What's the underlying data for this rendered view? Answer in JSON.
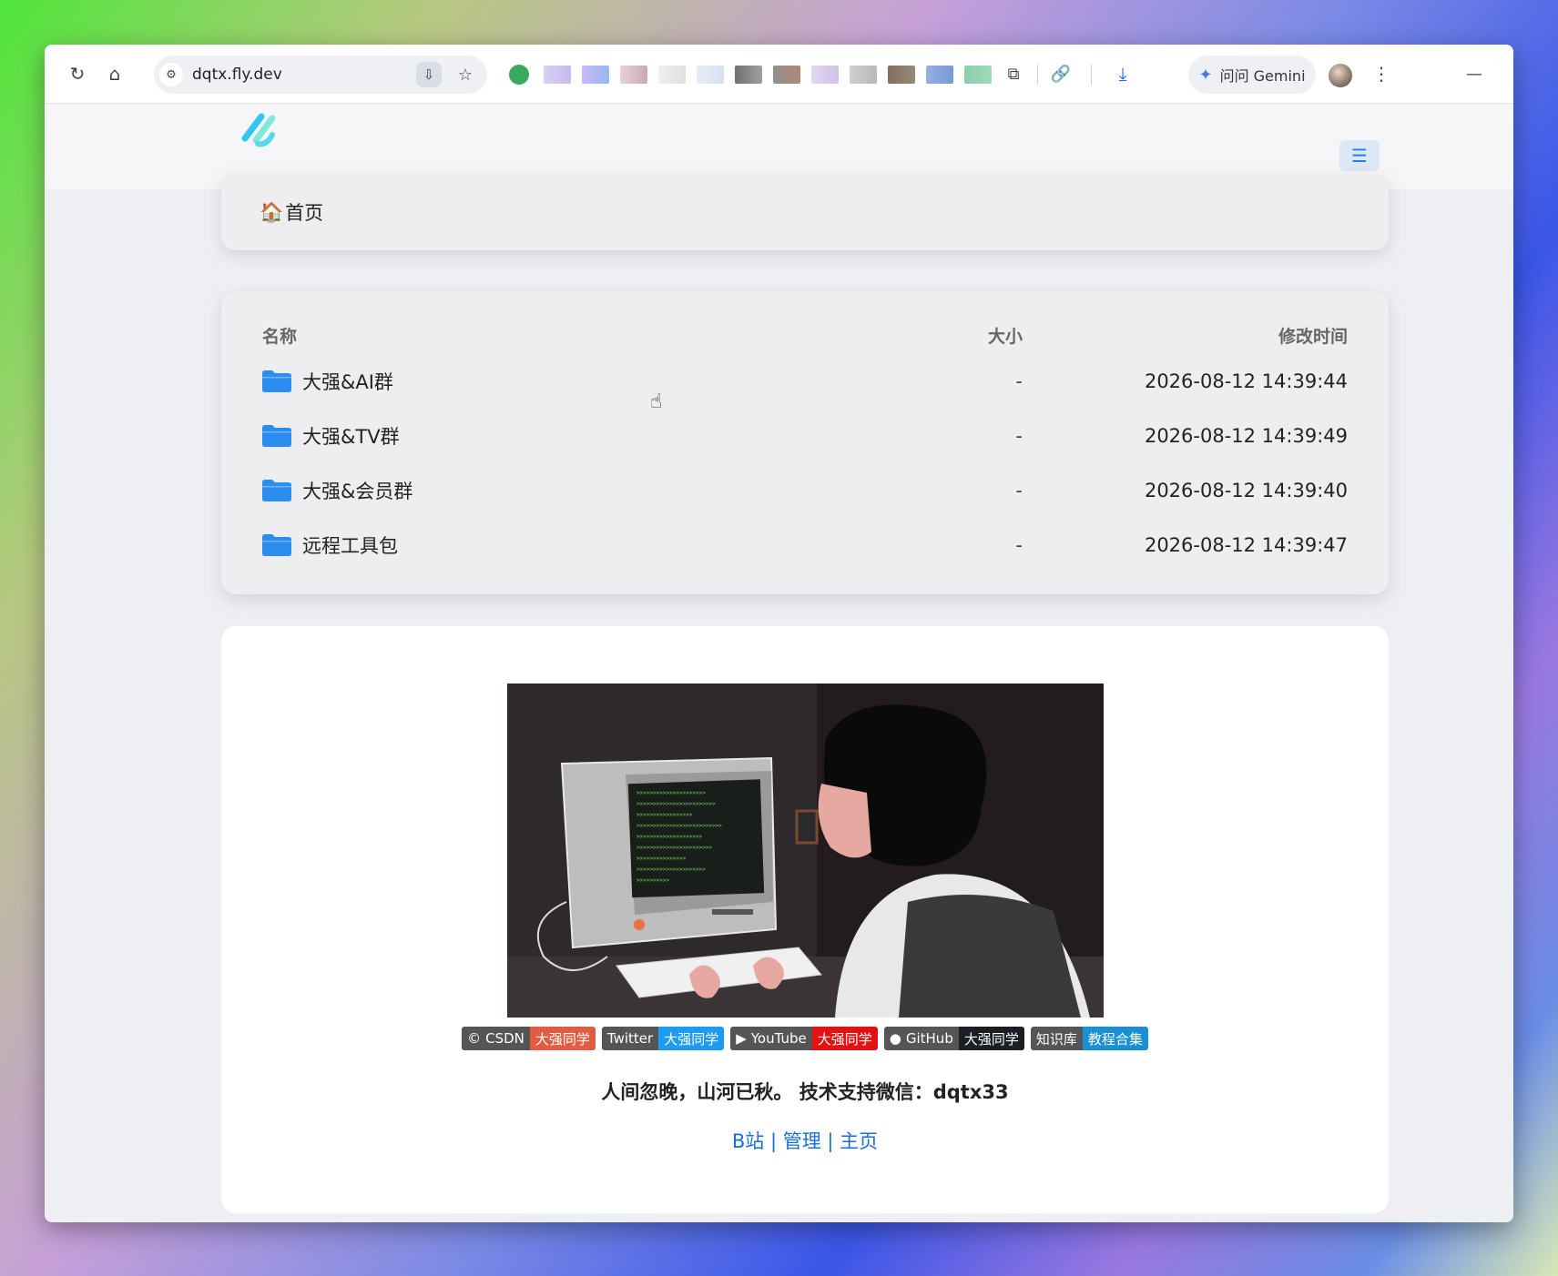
{
  "browser": {
    "url": "dqtx.fly.dev",
    "gemini_label": "问问 Gemini"
  },
  "breadcrumb": {
    "home_label": "首页"
  },
  "file_list": {
    "headers": {
      "name": "名称",
      "size": "大小",
      "modified": "修改时间"
    },
    "rows": [
      {
        "name": "大强&AI群",
        "size": "-",
        "modified": "2026-08-12 14:39:44"
      },
      {
        "name": "大强&TV群",
        "size": "-",
        "modified": "2026-08-12 14:39:49"
      },
      {
        "name": "大强&会员群",
        "size": "-",
        "modified": "2026-08-12 14:39:40"
      },
      {
        "name": "远程工具包",
        "size": "-",
        "modified": "2026-08-12 14:39:47"
      }
    ]
  },
  "readme": {
    "badges": [
      {
        "icon": "csdn-icon",
        "left": "CSDN",
        "right": "大强同学",
        "color": "#e05d44"
      },
      {
        "icon": "",
        "left": "Twitter",
        "right": "大强同学",
        "color": "#1d9bf0"
      },
      {
        "icon": "youtube-icon",
        "left": "YouTube",
        "right": "大强同学",
        "color": "#e31212"
      },
      {
        "icon": "github-icon",
        "left": "GitHub",
        "right": "大强同学",
        "color": "#1b1f24"
      },
      {
        "icon": "",
        "left": "知识库",
        "right": "教程合集",
        "color": "#1a8fd4"
      }
    ],
    "quote": "人间忽晚，山河已秋。 技术支持微信：dqtx33",
    "links": [
      "B站",
      "管理",
      "主页"
    ]
  },
  "colors": {
    "accent": "#1a6fd4",
    "folder": "#2b8df0"
  }
}
